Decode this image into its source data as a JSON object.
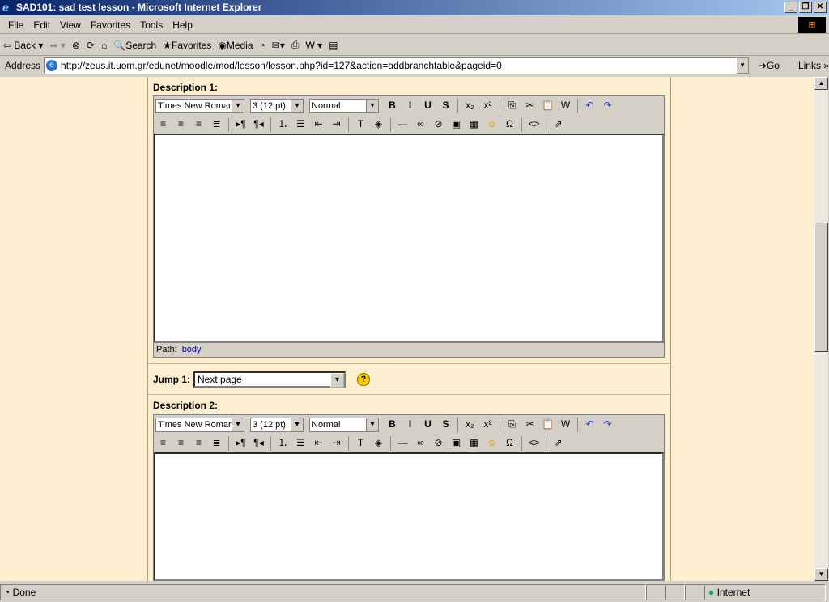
{
  "window": {
    "title": "SAD101: sad test lesson - Microsoft Internet Explorer",
    "controls": [
      "_",
      "❐",
      "✕"
    ]
  },
  "menu": [
    "File",
    "Edit",
    "View",
    "Favorites",
    "Tools",
    "Help"
  ],
  "toolbar": {
    "back": "Back",
    "search": "Search",
    "favorites": "Favorites",
    "media": "Media"
  },
  "address": {
    "label": "Address",
    "url": "http://zeus.it.uom.gr/edunet/moodle/mod/lesson/lesson.php?id=127&action=addbranchtable&pageid=0",
    "go": "Go",
    "links": "Links"
  },
  "editor_toolbar": {
    "font": "Times New Roman",
    "size": "3 (12 pt)",
    "format": "Normal",
    "row1": [
      [
        "bold-icon",
        "B"
      ],
      [
        "italic-icon",
        "I"
      ],
      [
        "underline-icon",
        "U"
      ],
      [
        "strikethrough-icon",
        "S"
      ],
      [
        "sep",
        ""
      ],
      [
        "subscript-icon",
        "x₂"
      ],
      [
        "superscript-icon",
        "x²"
      ],
      [
        "sep",
        ""
      ],
      [
        "copy-icon",
        "⎘"
      ],
      [
        "cut-icon",
        "✂"
      ],
      [
        "paste-icon",
        "📋"
      ],
      [
        "paste-word-icon",
        "W"
      ],
      [
        "sep",
        ""
      ],
      [
        "undo-icon",
        "↶"
      ],
      [
        "redo-icon",
        "↷"
      ]
    ],
    "row2": [
      [
        "align-left-icon",
        "≡"
      ],
      [
        "align-center-icon",
        "≡"
      ],
      [
        "align-right-icon",
        "≡"
      ],
      [
        "justify-icon",
        "≣"
      ],
      [
        "sep",
        ""
      ],
      [
        "ltr-icon",
        "▸¶"
      ],
      [
        "rtl-icon",
        "¶◂"
      ],
      [
        "sep",
        ""
      ],
      [
        "ordered-list-icon",
        "⒈"
      ],
      [
        "unordered-list-icon",
        "☰"
      ],
      [
        "outdent-icon",
        "⇤"
      ],
      [
        "indent-icon",
        "⇥"
      ],
      [
        "sep",
        ""
      ],
      [
        "text-color-icon",
        "T"
      ],
      [
        "bg-color-icon",
        "◈"
      ],
      [
        "sep",
        ""
      ],
      [
        "horizontal-rule-icon",
        "—"
      ],
      [
        "link-icon",
        "∞"
      ],
      [
        "unlink-icon",
        "⊘"
      ],
      [
        "image-icon",
        "▣"
      ],
      [
        "table-icon",
        "▦"
      ],
      [
        "smiley-icon",
        "☺"
      ],
      [
        "special-char-icon",
        "Ω"
      ],
      [
        "sep",
        ""
      ],
      [
        "html-source-icon",
        "<>"
      ],
      [
        "sep",
        ""
      ],
      [
        "fullscreen-icon",
        "⇗"
      ]
    ]
  },
  "description1": {
    "label": "Description 1:",
    "path_label": "Path:",
    "path_value": "body"
  },
  "jump1": {
    "label": "Jump 1:",
    "value": "Next page",
    "help": "?"
  },
  "description2": {
    "label": "Description 2:"
  },
  "status": {
    "text": "Done",
    "zone": "Internet"
  }
}
